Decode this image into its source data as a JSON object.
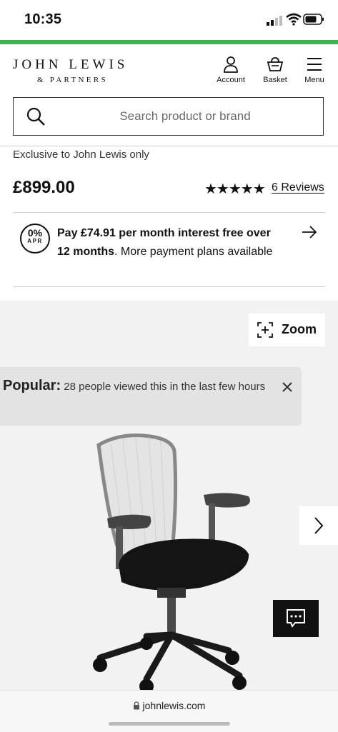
{
  "status_bar": {
    "time": "10:35"
  },
  "brand": {
    "line1": "JOHN LEWIS",
    "line2": "& PARTNERS"
  },
  "header_nav": {
    "account": "Account",
    "basket": "Basket",
    "menu": "Menu"
  },
  "search": {
    "placeholder": "Search product or brand"
  },
  "product": {
    "exclusive": "Exclusive to John Lewis only",
    "price": "£899.00",
    "stars": "★★★★★",
    "rating": 5,
    "reviews": "6 Reviews"
  },
  "finance": {
    "badge_percent": "0%",
    "badge_label": "APR",
    "bold": "Pay £74.91 per month interest free over 12 months",
    "rest": ". More payment plans available"
  },
  "gallery": {
    "zoom_label": "Zoom",
    "popular_label": "Popular:",
    "popular_text": " 28 people viewed this in the last few hours"
  },
  "browser": {
    "url": "johnlewis.com"
  },
  "colors": {
    "accent_green": "#3fb34f",
    "text": "#111111",
    "gallery_bg": "#f2f2f2"
  }
}
